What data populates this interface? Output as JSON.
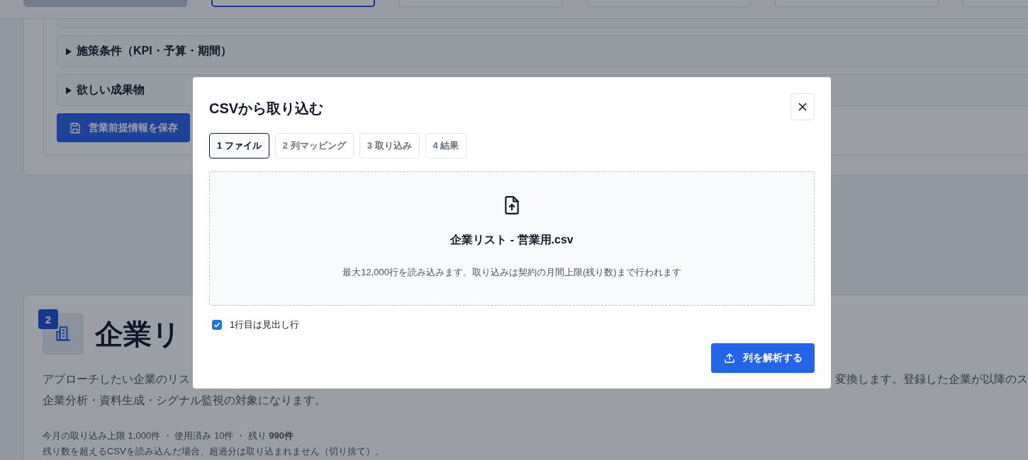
{
  "top_steps": [
    {
      "completed": true,
      "selected": false
    },
    {
      "completed": false,
      "selected": true
    },
    {
      "completed": false,
      "selected": false
    },
    {
      "completed": false,
      "selected": false
    },
    {
      "completed": false,
      "selected": false
    },
    {
      "completed": false,
      "selected": false
    }
  ],
  "accordions": [
    {
      "label": "施策条件（KPI・予算・期間）",
      "expanded": false
    },
    {
      "label": "欲しい成果物",
      "expanded": false
    }
  ],
  "save_button": "営業前提情報を保存",
  "company_section": {
    "step_number": "2",
    "heading": "企業リ",
    "description_left": "アプローチしたい企業のリス",
    "description_right": "変換します。登録した企業が以降のス",
    "description_line2": "企業分析・資料生成・シグナル監視の対象になります。",
    "quota": "今月の取り込み上限 1,000件 ・ 使用済み 10件 ・ 残り **990件**",
    "quota_note": "残り数を超えるCSVを読み込んだ場合、超過分は取り込まれません（切り捨て）。"
  },
  "dialog": {
    "title": "CSVから取り込む",
    "steps": [
      {
        "label": "1 ファイル",
        "selected": true
      },
      {
        "label": "2 列マッピング",
        "selected": false
      },
      {
        "label": "3 取り込み",
        "selected": false
      },
      {
        "label": "4 結果",
        "selected": false
      }
    ],
    "file_name": "企業リスト - 営業用.csv",
    "hint": "最大12,000行を読み込みます。取り込みは契約の月間上限(残り数)まで行われます",
    "header_row": {
      "label": "1行目は見出し行",
      "checked": true
    },
    "submit": "列を解析する"
  }
}
